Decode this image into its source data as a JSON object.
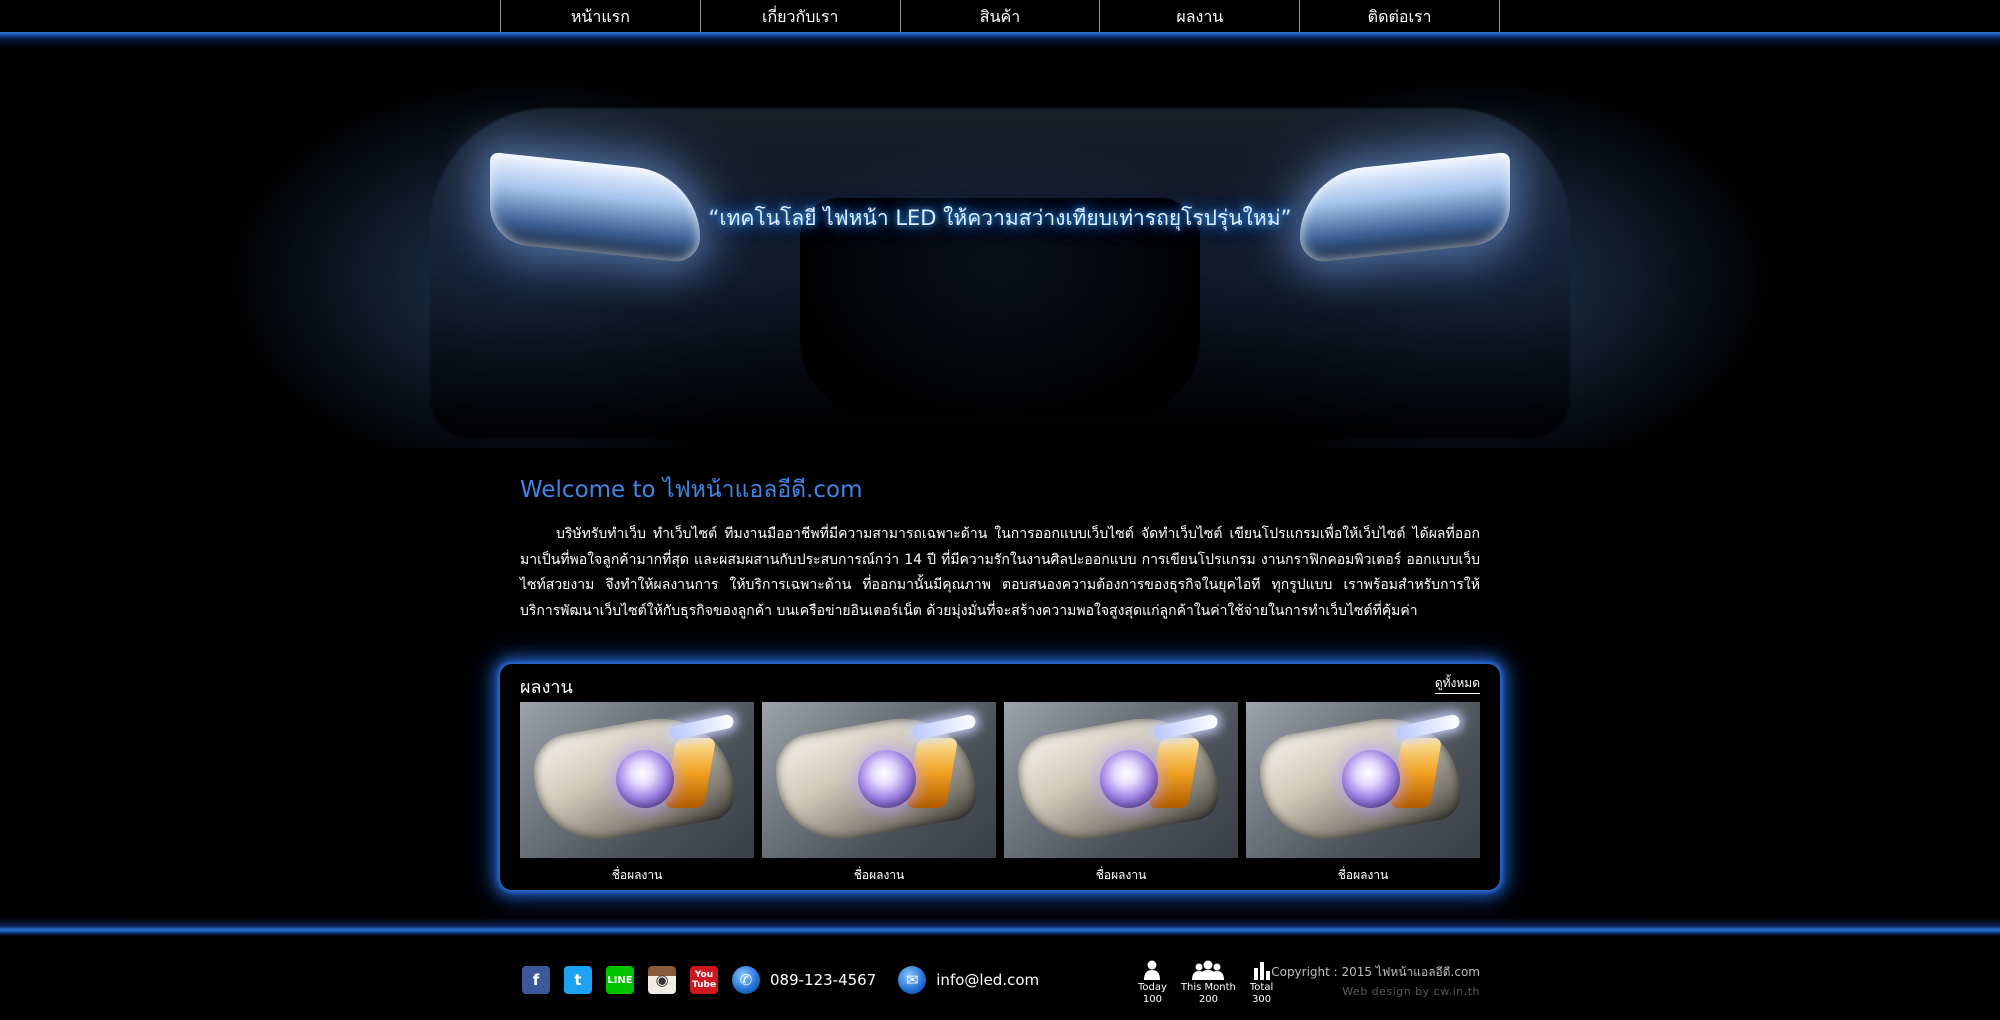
{
  "nav": {
    "items": [
      {
        "label": "หน้าแรก"
      },
      {
        "label": "เกี่ยวกับเรา"
      },
      {
        "label": "สินค้า"
      },
      {
        "label": "ผลงาน"
      },
      {
        "label": "ติดต่อเรา"
      }
    ]
  },
  "hero": {
    "tagline": "“เทคโนโลยี ไฟหน้า LED ให้ความสว่างเทียบเท่ารถยุโรปรุ่นใหม่”"
  },
  "welcome": {
    "title": "Welcome to ไฟหน้าแอลอีดี.com",
    "body": "บริษัทรับทำเว็บ ทำเว็บไซต์ ทีมงานมืออาชีพที่มีความสามารถเฉพาะด้าน ในการออกแบบเว็บไซต์ จัดทำเว็บไซต์ เขียนโปรแกรมเพื่อให้เว็บไซต์ ได้ผลที่ออกมาเป็นที่พอใจลูกค้ามากที่สุด และผสมผสานกับประสบการณ์กว่า 14 ปี ที่มีความรักในงานศิลปะออกแบบ การเขียนโปรแกรม งานกราฟิกคอมพิวเตอร์ ออกแบบเว็บไซท์สวยงาม จึงทำให้ผลงานการ ให้บริการเฉพาะด้าน ที่ออกมานั้นมีคุณภาพ ตอบสนองความต้องการของธุรกิจในยุคไอที ทุกรูปแบบ เราพร้อมสำหรับการให้บริการพัฒนาเว็บไซต์ให้กับธุรกิจของลูกค้า บนเครือข่ายอินเตอร์เน็ต ด้วยมุ่งมั่นที่จะสร้างความพอใจสูงสุดแก่ลูกค้าในค่าใช้จ่ายในการทำเว็บไซต์ที่คุ้มค่า"
  },
  "portfolio": {
    "title": "ผลงาน",
    "view_all": "ดูทั้งหมด",
    "items": [
      {
        "caption": "ชื่อผลงาน"
      },
      {
        "caption": "ชื่อผลงาน"
      },
      {
        "caption": "ชื่อผลงาน"
      },
      {
        "caption": "ชื่อผลงาน"
      }
    ]
  },
  "footer": {
    "social": [
      {
        "icon": "facebook-icon",
        "glyph": "f"
      },
      {
        "icon": "twitter-icon",
        "glyph": "t"
      },
      {
        "icon": "line-icon",
        "glyph": "LINE"
      },
      {
        "icon": "instagram-icon",
        "glyph": "◉"
      },
      {
        "icon": "youtube-icon",
        "glyph": "You Tube"
      }
    ],
    "phone_icon": "phone-icon",
    "phone": "089-123-4567",
    "email_icon": "mail-icon",
    "email": "info@led.com",
    "stats": [
      {
        "label": "Today",
        "value": "100",
        "icon": "user-icon"
      },
      {
        "label": "This Month",
        "value": "200",
        "icon": "users-icon"
      },
      {
        "label": "Total",
        "value": "300",
        "icon": "bar-chart-icon"
      }
    ],
    "copyright": "Copyright : 2015 ไฟหน้าแอลอีดี.com",
    "credit": "Web design by cw.in.th"
  },
  "colors": {
    "accent_blue": "#2f74d8",
    "welcome_title": "#3f86e6",
    "background": "#000000"
  }
}
